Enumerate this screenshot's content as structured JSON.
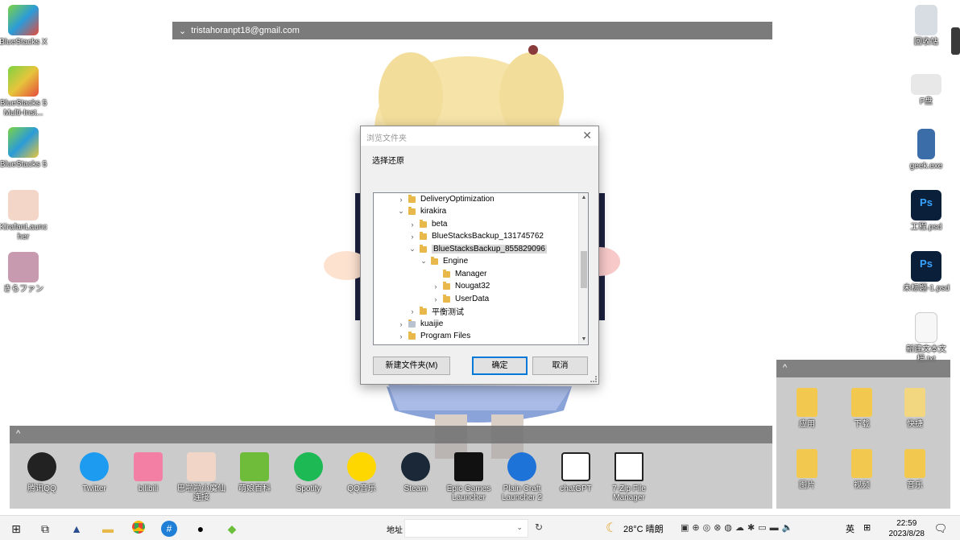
{
  "desktop": {
    "icons_left": [
      {
        "label": "BlueStacks X"
      },
      {
        "label": "BlueStacks 5 Multi-Inst..."
      },
      {
        "label": "BlueStacks 5"
      },
      {
        "label": "KirafanLauncher"
      },
      {
        "label": "きらファン"
      }
    ],
    "icons_right": [
      {
        "label": "回收站"
      },
      {
        "label": "F盘"
      },
      {
        "label": "geek.exe"
      },
      {
        "label": "工程.psd"
      },
      {
        "label": "未标题-1.psd"
      },
      {
        "label": "新建文本文档.txt"
      }
    ]
  },
  "top_bar": {
    "account": "tristahoranpt18@gmail.com"
  },
  "dialog": {
    "title": "浏览文件夹",
    "description": "选择还原",
    "tree": [
      {
        "label": "DeliveryOptimization",
        "arrow": "›"
      },
      {
        "label": "kirakira",
        "arrow": "⌄"
      },
      {
        "label": "beta",
        "arrow": "›"
      },
      {
        "label": "BlueStacksBackup_131745762",
        "arrow": "›"
      },
      {
        "label": "BlueStacksBackup_855829096",
        "arrow": "⌄"
      },
      {
        "label": "Engine",
        "arrow": "⌄"
      },
      {
        "label": "Manager",
        "arrow": ""
      },
      {
        "label": "Nougat32",
        "arrow": "›"
      },
      {
        "label": "UserData",
        "arrow": "›"
      },
      {
        "label": "平衡测试",
        "arrow": "›"
      },
      {
        "label": "kuaijie",
        "arrow": "›"
      },
      {
        "label": "Program Files",
        "arrow": "›"
      }
    ],
    "buttons": {
      "new_folder": "新建文件夹(M)",
      "ok": "确定",
      "cancel": "取消"
    }
  },
  "fence_bottom": {
    "items": [
      {
        "label": "腾讯QQ"
      },
      {
        "label": "Twitter"
      },
      {
        "label": "bilibili"
      },
      {
        "label": "巴啦啦小魔仙连接"
      },
      {
        "label": "萌娘百科"
      },
      {
        "label": "Spotify"
      },
      {
        "label": "QQ音乐"
      },
      {
        "label": "Steam"
      },
      {
        "label": "Epic Games Launcher"
      },
      {
        "label": "Plain Craft Launcher 2"
      },
      {
        "label": "chatGPT"
      },
      {
        "label": "7-Zip File Manager"
      }
    ]
  },
  "fence_right": {
    "items": [
      {
        "label": "应用"
      },
      {
        "label": "下载"
      },
      {
        "label": "快捷"
      },
      {
        "label": "图片"
      },
      {
        "label": "视频"
      },
      {
        "label": "音乐"
      }
    ]
  },
  "taskbar": {
    "address_label": "地址",
    "weather": "28°C 晴朗",
    "ime": "英",
    "time": "22:59",
    "date": "2023/8/28"
  },
  "colors": {
    "accent": "#0078d7",
    "fence": "#a0a0a0",
    "folder": "#e8b94a"
  }
}
